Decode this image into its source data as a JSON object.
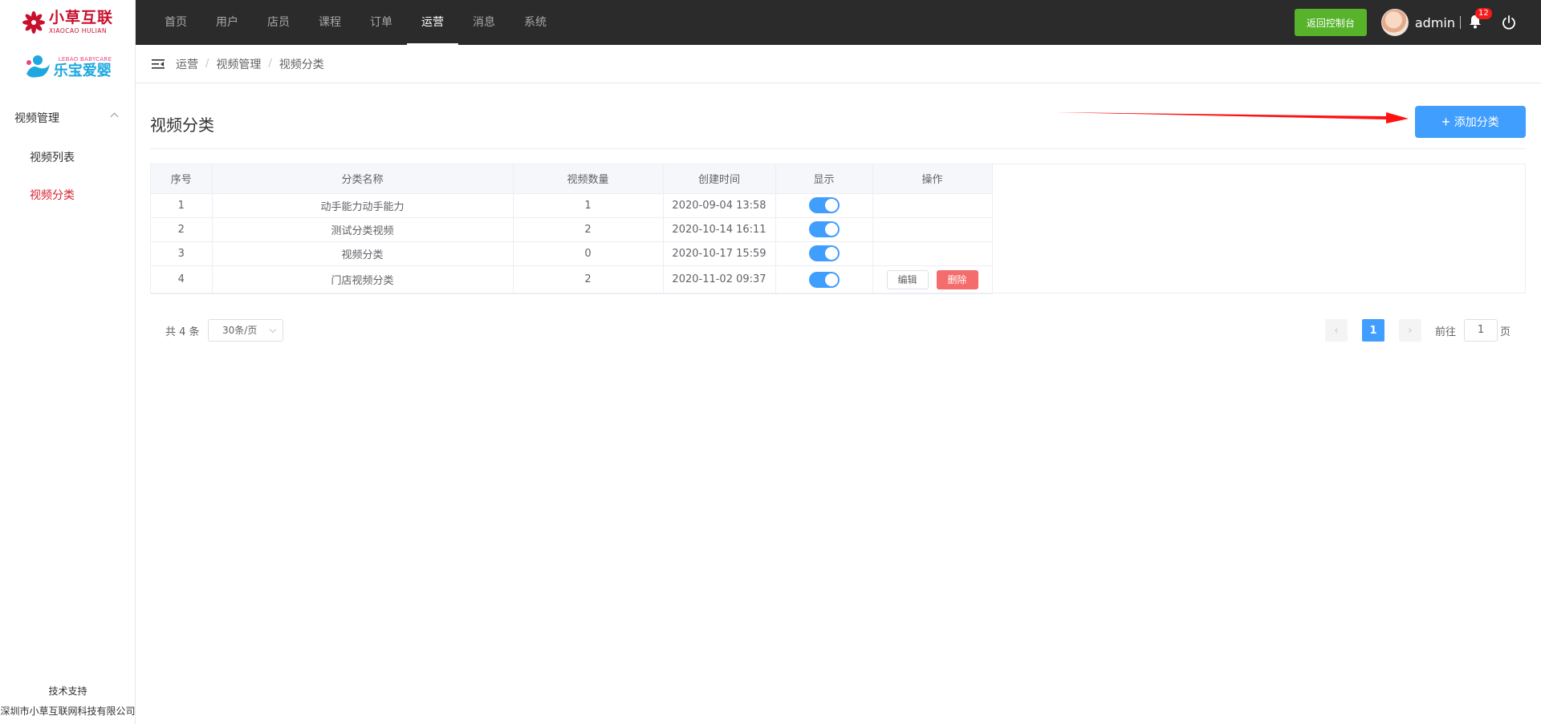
{
  "brand": {
    "name_cn": "小草互联",
    "name_en": "XIAOCAO HULIAN",
    "partner_en": "LEBAO BABYCARE",
    "partner_cn": "乐宝爱婴"
  },
  "sidebar": {
    "group_label": "视频管理",
    "items": [
      {
        "label": "视频列表",
        "active": false
      },
      {
        "label": "视频分类",
        "active": true
      }
    ],
    "footer_label": "技术支持",
    "footer_company": "深圳市小草互联网科技有限公司"
  },
  "topnav": {
    "items": [
      "首页",
      "用户",
      "店员",
      "课程",
      "订单",
      "运营",
      "消息",
      "系统"
    ],
    "active_index": 5,
    "console_button": "返回控制台",
    "username": "admin",
    "notification_count": "12"
  },
  "breadcrumb": [
    "运营",
    "视频管理",
    "视频分类"
  ],
  "page": {
    "title": "视频分类",
    "add_button": "添加分类",
    "accent": "#409eff"
  },
  "table": {
    "headers": [
      "序号",
      "分类名称",
      "视频数量",
      "创建时间",
      "显示",
      "操作"
    ],
    "rows": [
      {
        "index": "1",
        "name": "动手能力动手能力",
        "count": "1",
        "created": "2020-09-04 13:58",
        "shown": true
      },
      {
        "index": "2",
        "name": "测试分类视频",
        "count": "2",
        "created": "2020-10-14 16:11",
        "shown": true
      },
      {
        "index": "3",
        "name": "视频分类",
        "count": "0",
        "created": "2020-10-17 15:59",
        "shown": true
      },
      {
        "index": "4",
        "name": "门店视频分类",
        "count": "2",
        "created": "2020-11-02 09:37",
        "shown": true,
        "actions": {
          "edit": "编辑",
          "delete": "删除"
        }
      }
    ]
  },
  "pagination": {
    "total_text": "共 4 条",
    "page_size": "30条/页",
    "current_page": "1",
    "goto_label": "前往",
    "goto_value": "1",
    "goto_suffix": "页"
  }
}
